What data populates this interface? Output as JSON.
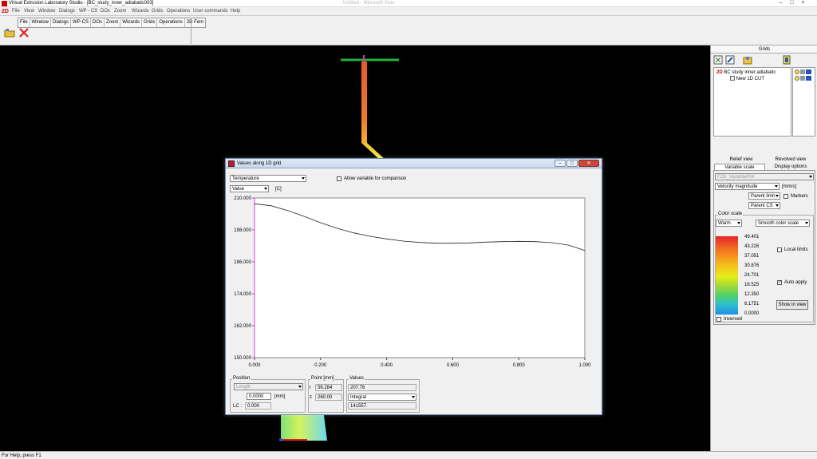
{
  "window": {
    "title": "Virtual Extrusion Laboratory Studio - [BC_study_inner_adiabatic003]",
    "ghost_title": "Untitled - Microsoft Visio"
  },
  "menu": {
    "logo": "2D",
    "items": [
      "File",
      "View",
      "Window",
      "Dialogs",
      "WP - CS",
      "DOs",
      "Zoom",
      "Wizards",
      "Grids",
      "Operations",
      "User commands",
      "Help"
    ]
  },
  "toolbar": {
    "strip": [
      "File",
      "Window",
      "Dialogs",
      "WP-CS",
      "DOs",
      "Zoom",
      "Wizards",
      "Grids",
      "Operations",
      "2D Fem"
    ]
  },
  "grids_panel": {
    "title": "Grids",
    "tree": {
      "root_prefix": "2D",
      "root_label": "BC study inner adiabatic",
      "child_label": "New 1D CUT"
    },
    "tabs": {
      "relief": "Relief view",
      "revolved": "Revolved view",
      "variable_scale": "Variable scale",
      "display_options": "Display options"
    },
    "variable_plot": "F2D_VariablePlot",
    "variable": "Velocity magnitude",
    "unit": "[mm/s]",
    "limit_mode": "Parent limit",
    "markers_label": "Markers",
    "cs_mode": "Parent CS",
    "color_scale": {
      "group_label": "Color scale",
      "palette": "Warm",
      "mode": "Smooth color scale",
      "values": [
        "49.401",
        "43.226",
        "37.051",
        "30.876",
        "24.701",
        "18.525",
        "12.350",
        "6.1751",
        "0.0000"
      ],
      "local_limits_label": "Local limits",
      "auto_apply_label": "Auto apply",
      "auto_apply_checked": "✓",
      "show_in_view_label": "Show in view",
      "inversed_label": "Inversed"
    }
  },
  "dialog": {
    "title": "Values along 1D grid",
    "variable": "Temperature",
    "allow_label": "Allow variable for comparison",
    "value_mode": "Value",
    "unit": "[C]",
    "position": {
      "group_label": "Position",
      "mode": "Length",
      "value": "0.0000",
      "unit": "[mm]",
      "lc_label": "LC :",
      "lc_value": "0.000"
    },
    "point": {
      "group_label": "Point [mm]",
      "r_label": "r",
      "r_value": "56.284",
      "z_label": "z",
      "z_value": "260.00"
    },
    "values": {
      "group_label": "Values",
      "value": "207.76",
      "mode": "Integral",
      "integral": "141557."
    }
  },
  "chart_data": {
    "type": "line",
    "title": "",
    "xlabel": "",
    "ylabel": "",
    "xlim": [
      0,
      1
    ],
    "ylim": [
      150,
      210
    ],
    "x_ticks": [
      "0.000",
      "0.200",
      "0.400",
      "0.600",
      "0.800",
      "1.000"
    ],
    "y_ticks": [
      "210.000",
      "198.000",
      "186.000",
      "174.000",
      "162.000",
      "150.000"
    ],
    "grid": false,
    "series": [
      {
        "x": [
          0.0,
          0.05,
          0.1,
          0.15,
          0.2,
          0.25,
          0.3,
          0.35,
          0.4,
          0.45,
          0.5,
          0.55,
          0.6,
          0.65,
          0.7,
          0.75,
          0.8,
          0.85,
          0.9,
          0.95,
          1.0
        ],
        "y": [
          207.8,
          207.1,
          205.3,
          203.1,
          200.7,
          198.6,
          196.9,
          195.6,
          194.6,
          193.8,
          193.3,
          193.0,
          193.0,
          193.1,
          193.4,
          193.6,
          193.7,
          193.6,
          193.2,
          192.3,
          190.3
        ]
      }
    ]
  },
  "status": {
    "text": "For Help, press F1"
  }
}
